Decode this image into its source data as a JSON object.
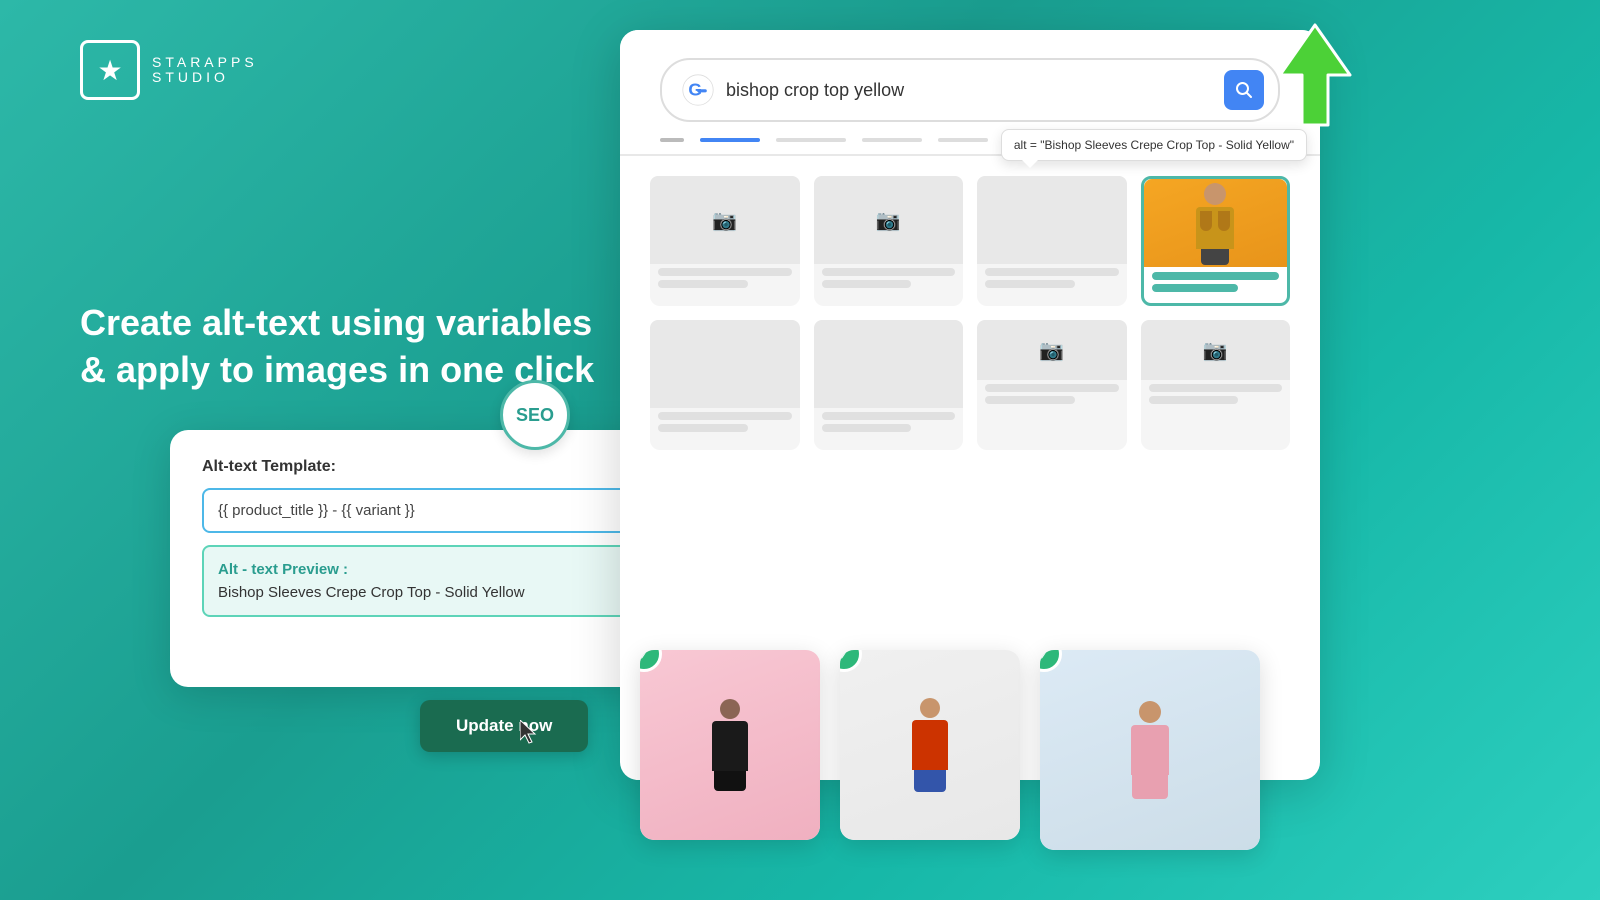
{
  "logo": {
    "name": "STARAPPS",
    "subtitle": "STUDIO",
    "star_icon": "★"
  },
  "headline": {
    "line1": "Create alt-text using variables",
    "line2": "& apply to images in one click"
  },
  "seo_badge": {
    "label": "SEO"
  },
  "template_card": {
    "label": "Alt-text Template:",
    "input_value": "{{ product_title }} - {{ variant }}",
    "preview_label": "Alt - text Preview :",
    "preview_text": "Bishop Sleeves Crepe Crop Top - Solid Yellow"
  },
  "update_button": {
    "label": "Update now"
  },
  "search": {
    "query": "bishop crop top yellow",
    "icon": "🔍"
  },
  "alt_tooltip": {
    "text": "alt = \"Bishop Sleeves Crepe Crop Top - Solid Yellow\""
  },
  "up_arrow": "↑",
  "fashion_images": [
    {
      "bg": "#1a1a1a",
      "description": "black outfit model"
    },
    {
      "bg": "#e8ede8",
      "description": "red shirt model"
    },
    {
      "bg": "#f0e4ea",
      "description": "pink outfit model"
    }
  ],
  "check_icon": "✓",
  "camera_icon": "📷"
}
